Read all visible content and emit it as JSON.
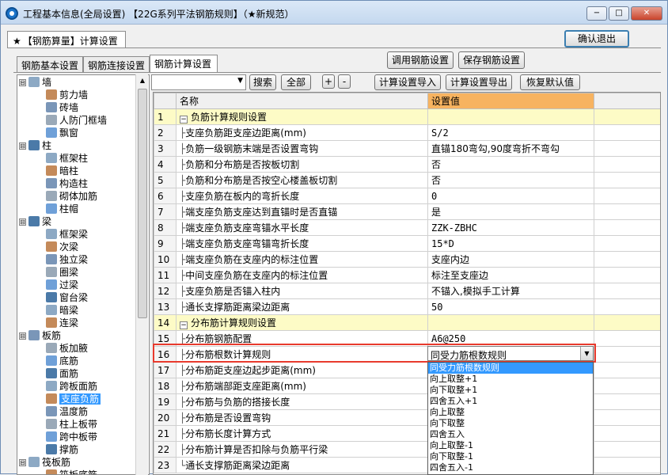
{
  "window": {
    "title": "工程基本信息(全局设置)  【22G系列平法钢筋规则】（★新规范）",
    "min": "−",
    "max": "□",
    "close": "✕"
  },
  "top_tab": "【钢筋算量】计算设置",
  "top_tab_star": "★",
  "confirm_exit": "确认退出",
  "call_settings": "调用钢筋设置",
  "save_settings": "保存钢筋设置",
  "subtabs": [
    "钢筋基本设置",
    "钢筋连接设置",
    "钢筋计算设置"
  ],
  "toolbar": {
    "search": "搜索",
    "all": "全部",
    "plus": "+",
    "minus": "-",
    "import": "计算设置导入",
    "export": "计算设置导出",
    "restore": "恢复默认值"
  },
  "tree": [
    {
      "label": "墙",
      "expander": "⊟"
    },
    {
      "label": "剪力墙"
    },
    {
      "label": "砖墙"
    },
    {
      "label": "人防门框墙"
    },
    {
      "label": "飘窗"
    },
    {
      "label": "柱",
      "expander": "⊟"
    },
    {
      "label": "框架柱"
    },
    {
      "label": "暗柱"
    },
    {
      "label": "构造柱"
    },
    {
      "label": "砌体加筋"
    },
    {
      "label": "柱帽"
    },
    {
      "label": "梁",
      "expander": "⊟"
    },
    {
      "label": "框架梁"
    },
    {
      "label": "次梁"
    },
    {
      "label": "独立梁"
    },
    {
      "label": "圈梁"
    },
    {
      "label": "过梁"
    },
    {
      "label": "窗台梁"
    },
    {
      "label": "暗梁"
    },
    {
      "label": "连梁"
    },
    {
      "label": "板筋",
      "expander": "⊟"
    },
    {
      "label": "板加腋"
    },
    {
      "label": "底筋"
    },
    {
      "label": "面筋"
    },
    {
      "label": "跨板面筋"
    },
    {
      "label": "支座负筋"
    },
    {
      "label": "温度筋"
    },
    {
      "label": "柱上板带"
    },
    {
      "label": "跨中板带"
    },
    {
      "label": "撑筋"
    },
    {
      "label": "筏板筋",
      "expander": "⊟"
    },
    {
      "label": "筏板底筋"
    }
  ],
  "grid": {
    "col_name": "名称",
    "col_value": "设置值",
    "rows": [
      {
        "n": "1",
        "name": "负筋计算规则设置",
        "value": "",
        "cat": true
      },
      {
        "n": "2",
        "name": "支座负筋距支座边距离(mm)",
        "value": "S/2"
      },
      {
        "n": "3",
        "name": "负筋一级钢筋末端是否设置弯钩",
        "value": "直锚180弯勾,90度弯折不弯勾"
      },
      {
        "n": "4",
        "name": "负筋和分布筋是否按板切割",
        "value": "否"
      },
      {
        "n": "5",
        "name": "负筋和分布筋是否按空心楼盖板切割",
        "value": "否"
      },
      {
        "n": "6",
        "name": "支座负筋在板内的弯折长度",
        "value": "0"
      },
      {
        "n": "7",
        "name": "端支座负筋支座达到直锚时是否直锚",
        "value": "是"
      },
      {
        "n": "8",
        "name": "端支座负筋支座弯锚水平长度",
        "value": "ZZK-ZBHC"
      },
      {
        "n": "9",
        "name": "端支座负筋支座弯锚弯折长度",
        "value": "15*D"
      },
      {
        "n": "10",
        "name": "端支座负筋在支座内的标注位置",
        "value": "支座内边"
      },
      {
        "n": "11",
        "name": "中间支座负筋在支座内的标注位置",
        "value": "标注至支座边"
      },
      {
        "n": "12",
        "name": "支座负筋是否锚入柱内",
        "value": "不锚入,模拟手工计算"
      },
      {
        "n": "13",
        "name": "通长支撑筋距离梁边距离",
        "value": "50"
      },
      {
        "n": "14",
        "name": "分布筋计算规则设置",
        "value": "",
        "cat": true
      },
      {
        "n": "15",
        "name": "分布筋钢筋配置",
        "value": "A6@250"
      },
      {
        "n": "16",
        "name": "分布筋根数计算规则",
        "value": ""
      },
      {
        "n": "17",
        "name": "分布筋距支座边起步距离(mm)",
        "value": ""
      },
      {
        "n": "18",
        "name": "分布筋端部距支座距离(mm)",
        "value": ""
      },
      {
        "n": "19",
        "name": "分布筋与负筋的搭接长度",
        "value": ""
      },
      {
        "n": "20",
        "name": "分布筋是否设置弯钩",
        "value": ""
      },
      {
        "n": "21",
        "name": "分布筋长度计算方式",
        "value": ""
      },
      {
        "n": "22",
        "name": "分布筋计算是否扣除与负筋平行梁",
        "value": ""
      },
      {
        "n": "23",
        "name": "通长支撑筋距离梁边距离",
        "value": ""
      }
    ]
  },
  "combo": {
    "value": "同受力筋根数规则",
    "arrow": "▼"
  },
  "dropdown_options": [
    "同受力筋根数规则",
    "向上取整+1",
    "向下取整+1",
    "四舍五入+1",
    "向上取整",
    "向下取整",
    "四舍五入",
    "向上取整-1",
    "向下取整-1",
    "四舍五入-1"
  ]
}
